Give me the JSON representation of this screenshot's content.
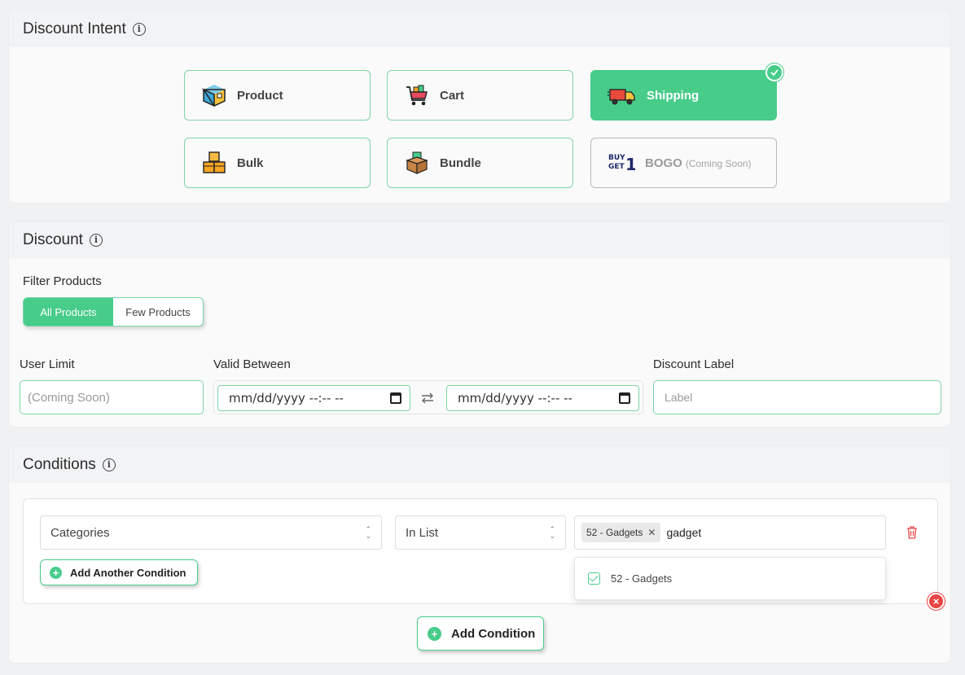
{
  "discount_intent": {
    "title": "Discount Intent",
    "options": [
      {
        "label": "Product",
        "icon": "box-icon"
      },
      {
        "label": "Cart",
        "icon": "cart-icon"
      },
      {
        "label": "Shipping",
        "icon": "truck-icon",
        "selected": true
      },
      {
        "label": "Bulk",
        "icon": "stacked-boxes-icon"
      },
      {
        "label": "Bundle",
        "icon": "open-box-icon"
      },
      {
        "label": "BOGO",
        "note": "(Coming Soon)",
        "icon": "buy-get-one-icon"
      }
    ],
    "bogo_logo_text": "BUY GET 1"
  },
  "discount": {
    "title": "Discount",
    "filter_label": "Filter Products",
    "filter_options": [
      "All Products",
      "Few Products"
    ],
    "filter_selected": "All Products",
    "user_limit_label": "User Limit",
    "user_limit_placeholder": "(Coming Soon)",
    "valid_between_label": "Valid Between",
    "date_start": "mm/dd/yyyy --:-- --",
    "date_end": "mm/dd/yyyy --:-- --",
    "discount_label_label": "Discount Label",
    "discount_label_placeholder": "Label"
  },
  "conditions": {
    "title": "Conditions",
    "field": "Categories",
    "operator": "In List",
    "tag": "52 - Gadgets",
    "search_text": "gadget",
    "dropdown_option": "52 - Gadgets",
    "add_another": "Add Another Condition",
    "add_condition": "Add Condition"
  },
  "colors": {
    "accent": "#47cc8a",
    "danger": "#e84545"
  }
}
